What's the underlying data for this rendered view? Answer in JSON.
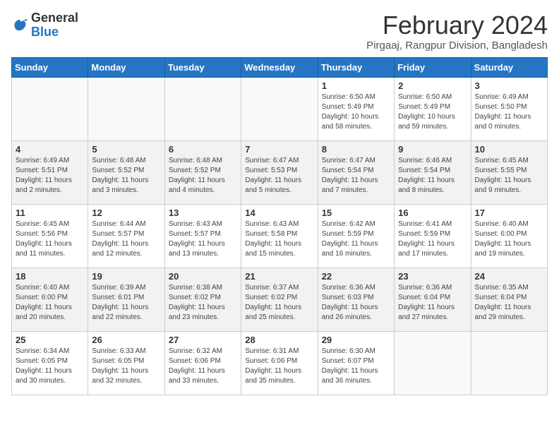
{
  "header": {
    "logo_general": "General",
    "logo_blue": "Blue",
    "title": "February 2024",
    "subtitle": "Pirgaaj, Rangpur Division, Bangladesh"
  },
  "days_of_week": [
    "Sunday",
    "Monday",
    "Tuesday",
    "Wednesday",
    "Thursday",
    "Friday",
    "Saturday"
  ],
  "weeks": [
    [
      {
        "num": "",
        "info": ""
      },
      {
        "num": "",
        "info": ""
      },
      {
        "num": "",
        "info": ""
      },
      {
        "num": "",
        "info": ""
      },
      {
        "num": "1",
        "info": "Sunrise: 6:50 AM\nSunset: 5:49 PM\nDaylight: 10 hours and 58 minutes."
      },
      {
        "num": "2",
        "info": "Sunrise: 6:50 AM\nSunset: 5:49 PM\nDaylight: 10 hours and 59 minutes."
      },
      {
        "num": "3",
        "info": "Sunrise: 6:49 AM\nSunset: 5:50 PM\nDaylight: 11 hours and 0 minutes."
      }
    ],
    [
      {
        "num": "4",
        "info": "Sunrise: 6:49 AM\nSunset: 5:51 PM\nDaylight: 11 hours and 2 minutes."
      },
      {
        "num": "5",
        "info": "Sunrise: 6:48 AM\nSunset: 5:52 PM\nDaylight: 11 hours and 3 minutes."
      },
      {
        "num": "6",
        "info": "Sunrise: 6:48 AM\nSunset: 5:52 PM\nDaylight: 11 hours and 4 minutes."
      },
      {
        "num": "7",
        "info": "Sunrise: 6:47 AM\nSunset: 5:53 PM\nDaylight: 11 hours and 5 minutes."
      },
      {
        "num": "8",
        "info": "Sunrise: 6:47 AM\nSunset: 5:54 PM\nDaylight: 11 hours and 7 minutes."
      },
      {
        "num": "9",
        "info": "Sunrise: 6:46 AM\nSunset: 5:54 PM\nDaylight: 11 hours and 8 minutes."
      },
      {
        "num": "10",
        "info": "Sunrise: 6:45 AM\nSunset: 5:55 PM\nDaylight: 11 hours and 9 minutes."
      }
    ],
    [
      {
        "num": "11",
        "info": "Sunrise: 6:45 AM\nSunset: 5:56 PM\nDaylight: 11 hours and 11 minutes."
      },
      {
        "num": "12",
        "info": "Sunrise: 6:44 AM\nSunset: 5:57 PM\nDaylight: 11 hours and 12 minutes."
      },
      {
        "num": "13",
        "info": "Sunrise: 6:43 AM\nSunset: 5:57 PM\nDaylight: 11 hours and 13 minutes."
      },
      {
        "num": "14",
        "info": "Sunrise: 6:43 AM\nSunset: 5:58 PM\nDaylight: 11 hours and 15 minutes."
      },
      {
        "num": "15",
        "info": "Sunrise: 6:42 AM\nSunset: 5:59 PM\nDaylight: 11 hours and 16 minutes."
      },
      {
        "num": "16",
        "info": "Sunrise: 6:41 AM\nSunset: 5:59 PM\nDaylight: 11 hours and 17 minutes."
      },
      {
        "num": "17",
        "info": "Sunrise: 6:40 AM\nSunset: 6:00 PM\nDaylight: 11 hours and 19 minutes."
      }
    ],
    [
      {
        "num": "18",
        "info": "Sunrise: 6:40 AM\nSunset: 6:00 PM\nDaylight: 11 hours and 20 minutes."
      },
      {
        "num": "19",
        "info": "Sunrise: 6:39 AM\nSunset: 6:01 PM\nDaylight: 11 hours and 22 minutes."
      },
      {
        "num": "20",
        "info": "Sunrise: 6:38 AM\nSunset: 6:02 PM\nDaylight: 11 hours and 23 minutes."
      },
      {
        "num": "21",
        "info": "Sunrise: 6:37 AM\nSunset: 6:02 PM\nDaylight: 11 hours and 25 minutes."
      },
      {
        "num": "22",
        "info": "Sunrise: 6:36 AM\nSunset: 6:03 PM\nDaylight: 11 hours and 26 minutes."
      },
      {
        "num": "23",
        "info": "Sunrise: 6:36 AM\nSunset: 6:04 PM\nDaylight: 11 hours and 27 minutes."
      },
      {
        "num": "24",
        "info": "Sunrise: 6:35 AM\nSunset: 6:04 PM\nDaylight: 11 hours and 29 minutes."
      }
    ],
    [
      {
        "num": "25",
        "info": "Sunrise: 6:34 AM\nSunset: 6:05 PM\nDaylight: 11 hours and 30 minutes."
      },
      {
        "num": "26",
        "info": "Sunrise: 6:33 AM\nSunset: 6:05 PM\nDaylight: 11 hours and 32 minutes."
      },
      {
        "num": "27",
        "info": "Sunrise: 6:32 AM\nSunset: 6:06 PM\nDaylight: 11 hours and 33 minutes."
      },
      {
        "num": "28",
        "info": "Sunrise: 6:31 AM\nSunset: 6:06 PM\nDaylight: 11 hours and 35 minutes."
      },
      {
        "num": "29",
        "info": "Sunrise: 6:30 AM\nSunset: 6:07 PM\nDaylight: 11 hours and 36 minutes."
      },
      {
        "num": "",
        "info": ""
      },
      {
        "num": "",
        "info": ""
      }
    ]
  ]
}
